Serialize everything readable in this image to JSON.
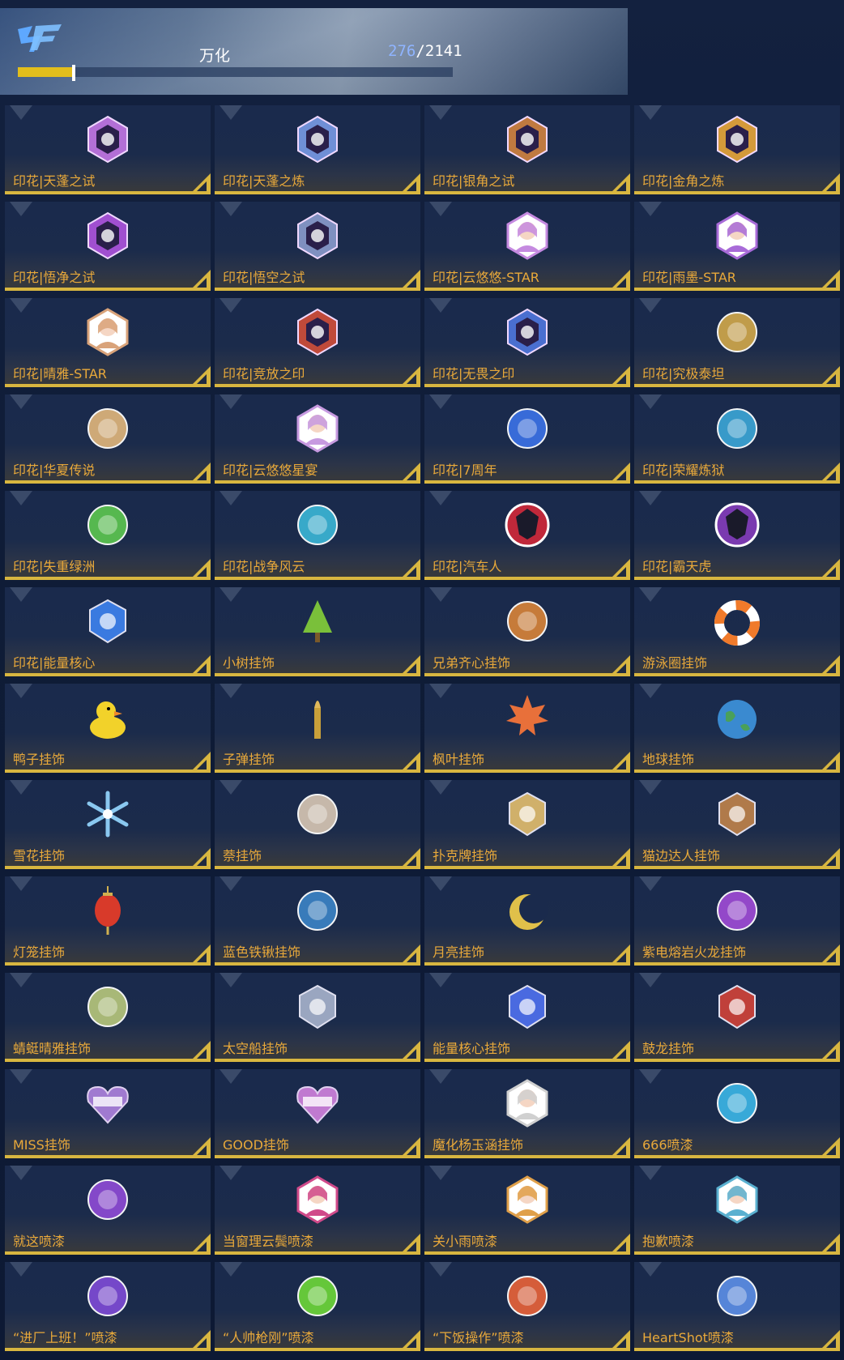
{
  "header": {
    "logo_icon": "crossfire-logo-icon",
    "title": "万化",
    "count_current": "276",
    "count_separator": "/",
    "count_total": "2141",
    "progress": 0.129,
    "accent_color": "#e2be1c",
    "count_color": "#8fb4ff"
  },
  "items": [
    {
      "label": "印花|天蓬之试",
      "icon": "s5-rank-badge-icon",
      "color": "#b36fd6"
    },
    {
      "label": "印花|天蓬之炼",
      "icon": "s5-rank-badge-icon",
      "color": "#6f8fd6"
    },
    {
      "label": "印花|银角之试",
      "icon": "s6-rank-badge-icon",
      "color": "#c07a40"
    },
    {
      "label": "印花|金角之炼",
      "icon": "s6-rank-badge-icon",
      "color": "#d49a3a"
    },
    {
      "label": "印花|悟净之试",
      "icon": "s7-rank-badge-icon",
      "color": "#a04fd0"
    },
    {
      "label": "印花|悟空之试",
      "icon": "s8-rank-badge-icon",
      "color": "#7f90c0"
    },
    {
      "label": "印花|云悠悠-STAR",
      "icon": "character-portrait-icon",
      "color": "#c58ae0"
    },
    {
      "label": "印花|雨墨-STAR",
      "icon": "character-portrait-icon",
      "color": "#a86bd8"
    },
    {
      "label": "印花|晴雅-STAR",
      "icon": "character-portrait-icon",
      "color": "#d9a37a"
    },
    {
      "label": "印花|竞放之印",
      "icon": "s3-rank-badge-icon",
      "color": "#c04a3a"
    },
    {
      "label": "印花|无畏之印",
      "icon": "s4-rank-badge-icon",
      "color": "#4a6fd0"
    },
    {
      "label": "印花|究极泰坦",
      "icon": "golden-mech-icon",
      "color": "#c9a34a"
    },
    {
      "label": "印花|华夏传说",
      "icon": "great-wall-seal-icon",
      "color": "#d8b07a"
    },
    {
      "label": "印花|云悠悠星宴",
      "icon": "character-portrait-icon",
      "color": "#c79ae0"
    },
    {
      "label": "印花|7周年",
      "icon": "anniversary-7-icon",
      "color": "#3a6fe0"
    },
    {
      "label": "印花|荣耀炼狱",
      "icon": "dragon-warrior-icon",
      "color": "#3aa0d0"
    },
    {
      "label": "印花|失重绿洲",
      "icon": "planet-ring-icon",
      "color": "#5ac050"
    },
    {
      "label": "印花|战争风云",
      "icon": "drone-icon",
      "color": "#3ab0d0"
    },
    {
      "label": "印花|汽车人",
      "icon": "autobot-emblem-icon",
      "color": "#c0283a"
    },
    {
      "label": "印花|霸天虎",
      "icon": "decepticon-emblem-icon",
      "color": "#7a3ab0"
    },
    {
      "label": "印花|能量核心",
      "icon": "energy-core-icon",
      "color": "#3a7ae0"
    },
    {
      "label": "小树挂饰",
      "icon": "tree-icon",
      "color": "#7ac03a"
    },
    {
      "label": "兄弟齐心挂饰",
      "icon": "brothers-charm-icon",
      "color": "#d0803a"
    },
    {
      "label": "游泳圈挂饰",
      "icon": "swim-ring-icon",
      "color": "#f07a2a"
    },
    {
      "label": "鸭子挂饰",
      "icon": "rubber-duck-icon",
      "color": "#f2d22a"
    },
    {
      "label": "子弹挂饰",
      "icon": "bullet-icon",
      "color": "#c9a03a"
    },
    {
      "label": "枫叶挂饰",
      "icon": "maple-leaf-icon",
      "color": "#e8703a"
    },
    {
      "label": "地球挂饰",
      "icon": "earth-globe-icon",
      "color": "#3a8ad0"
    },
    {
      "label": "雪花挂饰",
      "icon": "snowflake-icon",
      "color": "#8ac8f0"
    },
    {
      "label": "萘挂饰",
      "icon": "chibi-soldier-icon",
      "color": "#d0c0b0"
    },
    {
      "label": "扑克牌挂饰",
      "icon": "poker-chip-icon",
      "color": "#d0b06a"
    },
    {
      "label": "猫边达人挂饰",
      "icon": "shield-badge-icon",
      "color": "#b07a4a"
    },
    {
      "label": "灯笼挂饰",
      "icon": "lantern-icon",
      "color": "#d83a2a"
    },
    {
      "label": "蓝色铁锹挂饰",
      "icon": "blue-shovel-icon",
      "color": "#3a80c0"
    },
    {
      "label": "月亮挂饰",
      "icon": "moon-charm-icon",
      "color": "#e0c04a"
    },
    {
      "label": "紫电熔岩火龙挂饰",
      "icon": "purple-dragon-icon",
      "color": "#9a4ad0"
    },
    {
      "label": "蜻蜓晴雅挂饰",
      "icon": "dragonfly-icon",
      "color": "#b0c07a"
    },
    {
      "label": "太空船挂饰",
      "icon": "spaceship-icon",
      "color": "#9aa6c0"
    },
    {
      "label": "能量核心挂饰",
      "icon": "energy-core-icon",
      "color": "#4a6ae0"
    },
    {
      "label": "鼓龙挂饰",
      "icon": "dragon-drum-icon",
      "color": "#c0403a"
    },
    {
      "label": "MISS挂饰",
      "icon": "miss-heart-icon",
      "color": "#a07ad0"
    },
    {
      "label": "GOOD挂饰",
      "icon": "good-heart-icon",
      "color": "#c07ad0"
    },
    {
      "label": "魔化杨玉涵挂饰",
      "icon": "masked-girl-icon",
      "color": "#d0d0d0"
    },
    {
      "label": "666喷漆",
      "icon": "spray-666-icon",
      "color": "#3ab0e0"
    },
    {
      "label": "就这喷漆",
      "icon": "spray-star-icon",
      "color": "#8a4ad0"
    },
    {
      "label": "当窗理云鬓喷漆",
      "icon": "spray-girl-icon",
      "color": "#d04a8a"
    },
    {
      "label": "关小雨喷漆",
      "icon": "spray-girl-icon",
      "color": "#e0a04a"
    },
    {
      "label": "抱歉喷漆",
      "icon": "spray-boy-icon",
      "color": "#5ab0d0"
    },
    {
      "label": "“进厂上班！”喷漆",
      "icon": "spray-text-icon",
      "color": "#7a4ad0"
    },
    {
      "label": "“人帅枪刚”喷漆",
      "icon": "spray-splash-icon",
      "color": "#6ad03a"
    },
    {
      "label": "“下饭操作”喷漆",
      "icon": "spray-bowl-icon",
      "color": "#e0603a"
    },
    {
      "label": "HeartShot喷漆",
      "icon": "heartshot-wings-icon",
      "color": "#5a8ae0"
    }
  ]
}
